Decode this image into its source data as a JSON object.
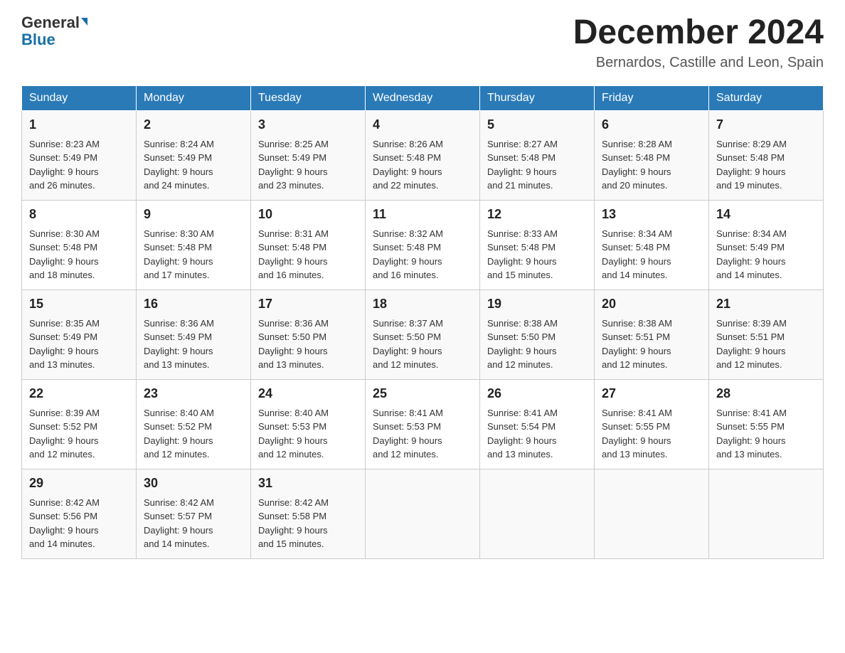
{
  "header": {
    "logo_general": "General",
    "logo_blue": "Blue",
    "month_title": "December 2024",
    "location": "Bernardos, Castille and Leon, Spain"
  },
  "weekdays": [
    "Sunday",
    "Monday",
    "Tuesday",
    "Wednesday",
    "Thursday",
    "Friday",
    "Saturday"
  ],
  "weeks": [
    [
      {
        "day": "1",
        "sunrise": "8:23 AM",
        "sunset": "5:49 PM",
        "daylight": "9 hours and 26 minutes."
      },
      {
        "day": "2",
        "sunrise": "8:24 AM",
        "sunset": "5:49 PM",
        "daylight": "9 hours and 24 minutes."
      },
      {
        "day": "3",
        "sunrise": "8:25 AM",
        "sunset": "5:49 PM",
        "daylight": "9 hours and 23 minutes."
      },
      {
        "day": "4",
        "sunrise": "8:26 AM",
        "sunset": "5:48 PM",
        "daylight": "9 hours and 22 minutes."
      },
      {
        "day": "5",
        "sunrise": "8:27 AM",
        "sunset": "5:48 PM",
        "daylight": "9 hours and 21 minutes."
      },
      {
        "day": "6",
        "sunrise": "8:28 AM",
        "sunset": "5:48 PM",
        "daylight": "9 hours and 20 minutes."
      },
      {
        "day": "7",
        "sunrise": "8:29 AM",
        "sunset": "5:48 PM",
        "daylight": "9 hours and 19 minutes."
      }
    ],
    [
      {
        "day": "8",
        "sunrise": "8:30 AM",
        "sunset": "5:48 PM",
        "daylight": "9 hours and 18 minutes."
      },
      {
        "day": "9",
        "sunrise": "8:30 AM",
        "sunset": "5:48 PM",
        "daylight": "9 hours and 17 minutes."
      },
      {
        "day": "10",
        "sunrise": "8:31 AM",
        "sunset": "5:48 PM",
        "daylight": "9 hours and 16 minutes."
      },
      {
        "day": "11",
        "sunrise": "8:32 AM",
        "sunset": "5:48 PM",
        "daylight": "9 hours and 16 minutes."
      },
      {
        "day": "12",
        "sunrise": "8:33 AM",
        "sunset": "5:48 PM",
        "daylight": "9 hours and 15 minutes."
      },
      {
        "day": "13",
        "sunrise": "8:34 AM",
        "sunset": "5:48 PM",
        "daylight": "9 hours and 14 minutes."
      },
      {
        "day": "14",
        "sunrise": "8:34 AM",
        "sunset": "5:49 PM",
        "daylight": "9 hours and 14 minutes."
      }
    ],
    [
      {
        "day": "15",
        "sunrise": "8:35 AM",
        "sunset": "5:49 PM",
        "daylight": "9 hours and 13 minutes."
      },
      {
        "day": "16",
        "sunrise": "8:36 AM",
        "sunset": "5:49 PM",
        "daylight": "9 hours and 13 minutes."
      },
      {
        "day": "17",
        "sunrise": "8:36 AM",
        "sunset": "5:50 PM",
        "daylight": "9 hours and 13 minutes."
      },
      {
        "day": "18",
        "sunrise": "8:37 AM",
        "sunset": "5:50 PM",
        "daylight": "9 hours and 12 minutes."
      },
      {
        "day": "19",
        "sunrise": "8:38 AM",
        "sunset": "5:50 PM",
        "daylight": "9 hours and 12 minutes."
      },
      {
        "day": "20",
        "sunrise": "8:38 AM",
        "sunset": "5:51 PM",
        "daylight": "9 hours and 12 minutes."
      },
      {
        "day": "21",
        "sunrise": "8:39 AM",
        "sunset": "5:51 PM",
        "daylight": "9 hours and 12 minutes."
      }
    ],
    [
      {
        "day": "22",
        "sunrise": "8:39 AM",
        "sunset": "5:52 PM",
        "daylight": "9 hours and 12 minutes."
      },
      {
        "day": "23",
        "sunrise": "8:40 AM",
        "sunset": "5:52 PM",
        "daylight": "9 hours and 12 minutes."
      },
      {
        "day": "24",
        "sunrise": "8:40 AM",
        "sunset": "5:53 PM",
        "daylight": "9 hours and 12 minutes."
      },
      {
        "day": "25",
        "sunrise": "8:41 AM",
        "sunset": "5:53 PM",
        "daylight": "9 hours and 12 minutes."
      },
      {
        "day": "26",
        "sunrise": "8:41 AM",
        "sunset": "5:54 PM",
        "daylight": "9 hours and 13 minutes."
      },
      {
        "day": "27",
        "sunrise": "8:41 AM",
        "sunset": "5:55 PM",
        "daylight": "9 hours and 13 minutes."
      },
      {
        "day": "28",
        "sunrise": "8:41 AM",
        "sunset": "5:55 PM",
        "daylight": "9 hours and 13 minutes."
      }
    ],
    [
      {
        "day": "29",
        "sunrise": "8:42 AM",
        "sunset": "5:56 PM",
        "daylight": "9 hours and 14 minutes."
      },
      {
        "day": "30",
        "sunrise": "8:42 AM",
        "sunset": "5:57 PM",
        "daylight": "9 hours and 14 minutes."
      },
      {
        "day": "31",
        "sunrise": "8:42 AM",
        "sunset": "5:58 PM",
        "daylight": "9 hours and 15 minutes."
      },
      null,
      null,
      null,
      null
    ]
  ],
  "labels": {
    "sunrise": "Sunrise:",
    "sunset": "Sunset:",
    "daylight": "Daylight:"
  }
}
